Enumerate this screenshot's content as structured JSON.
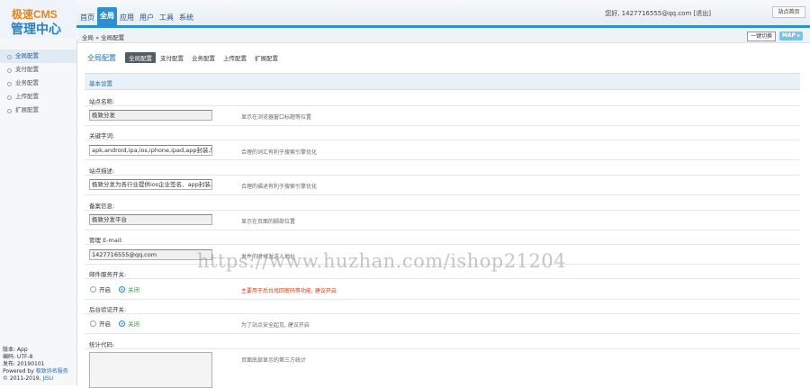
{
  "logo": {
    "line1": "极速CMS",
    "line2": "管理中心"
  },
  "main_nav": [
    "首页",
    "全局",
    "应用",
    "用户",
    "工具",
    "系统"
  ],
  "main_nav_active": 1,
  "user": {
    "greeting": "您好, 1427716555@qq.com",
    "logout": "[退出]",
    "site_home": "站点首页"
  },
  "breadcrumb": "全局 » 全局配置",
  "toolbar": {
    "clear_cache": "一键切换",
    "map": "MAP ▸"
  },
  "sidebar": {
    "items": [
      "全局配置",
      "支付配置",
      "业务配置",
      "上传配置",
      "扩展配置"
    ],
    "active": 0,
    "info": {
      "version": "版本: App",
      "encoding": "编码: UTF-8",
      "release": "发布: 20190101",
      "powered_prefix": "Powered by ",
      "powered_link": "极致协名服务",
      "copyright_prefix": "© 2011-2019, ",
      "copyright_link": "JISU"
    }
  },
  "page": {
    "title": "全局配置",
    "tabs": [
      "全局配置",
      "支付配置",
      "业务配置",
      "上传配置",
      "扩展配置"
    ],
    "active_tab": 0
  },
  "section_title": "基本设置",
  "fields": [
    {
      "label": "站点名称:",
      "value": "极致分发",
      "hint": "显示在浏览器窗口标题等位置"
    },
    {
      "label": "关键字词:",
      "value": "apk,android,ipa,ios,iphone,ipad,app封装,程",
      "hint": "合理的词汇有利于搜索引擎优化"
    },
    {
      "label": "站点描述:",
      "value": "极致分发为各行业提供ios企业签名、app封装、",
      "hint": "合理的描述有利于搜索引擎优化"
    },
    {
      "label": "备案信息:",
      "value": "极致分发平台",
      "hint": "显示在页面的脚部位置"
    },
    {
      "label": "管理 E-mail:",
      "value": "1427716555@qq.com",
      "hint": "发件的时候发送人地址"
    }
  ],
  "radio_fields": [
    {
      "label": "邮件服务开关:",
      "options": [
        "开启",
        "关闭"
      ],
      "selected": 1,
      "hint": "主要用于后台找回密码等功能, 建议开启"
    },
    {
      "label": "后台验证开关:",
      "options": [
        "开启",
        "关闭"
      ],
      "selected": 1,
      "hint": "为了站点安全起见, 建议开启"
    }
  ],
  "stats_field": {
    "label": "统计代码:",
    "hint": "页面底部显示的第三方统计"
  },
  "watermark": "https://www.huzhan.com/ishop21204"
}
